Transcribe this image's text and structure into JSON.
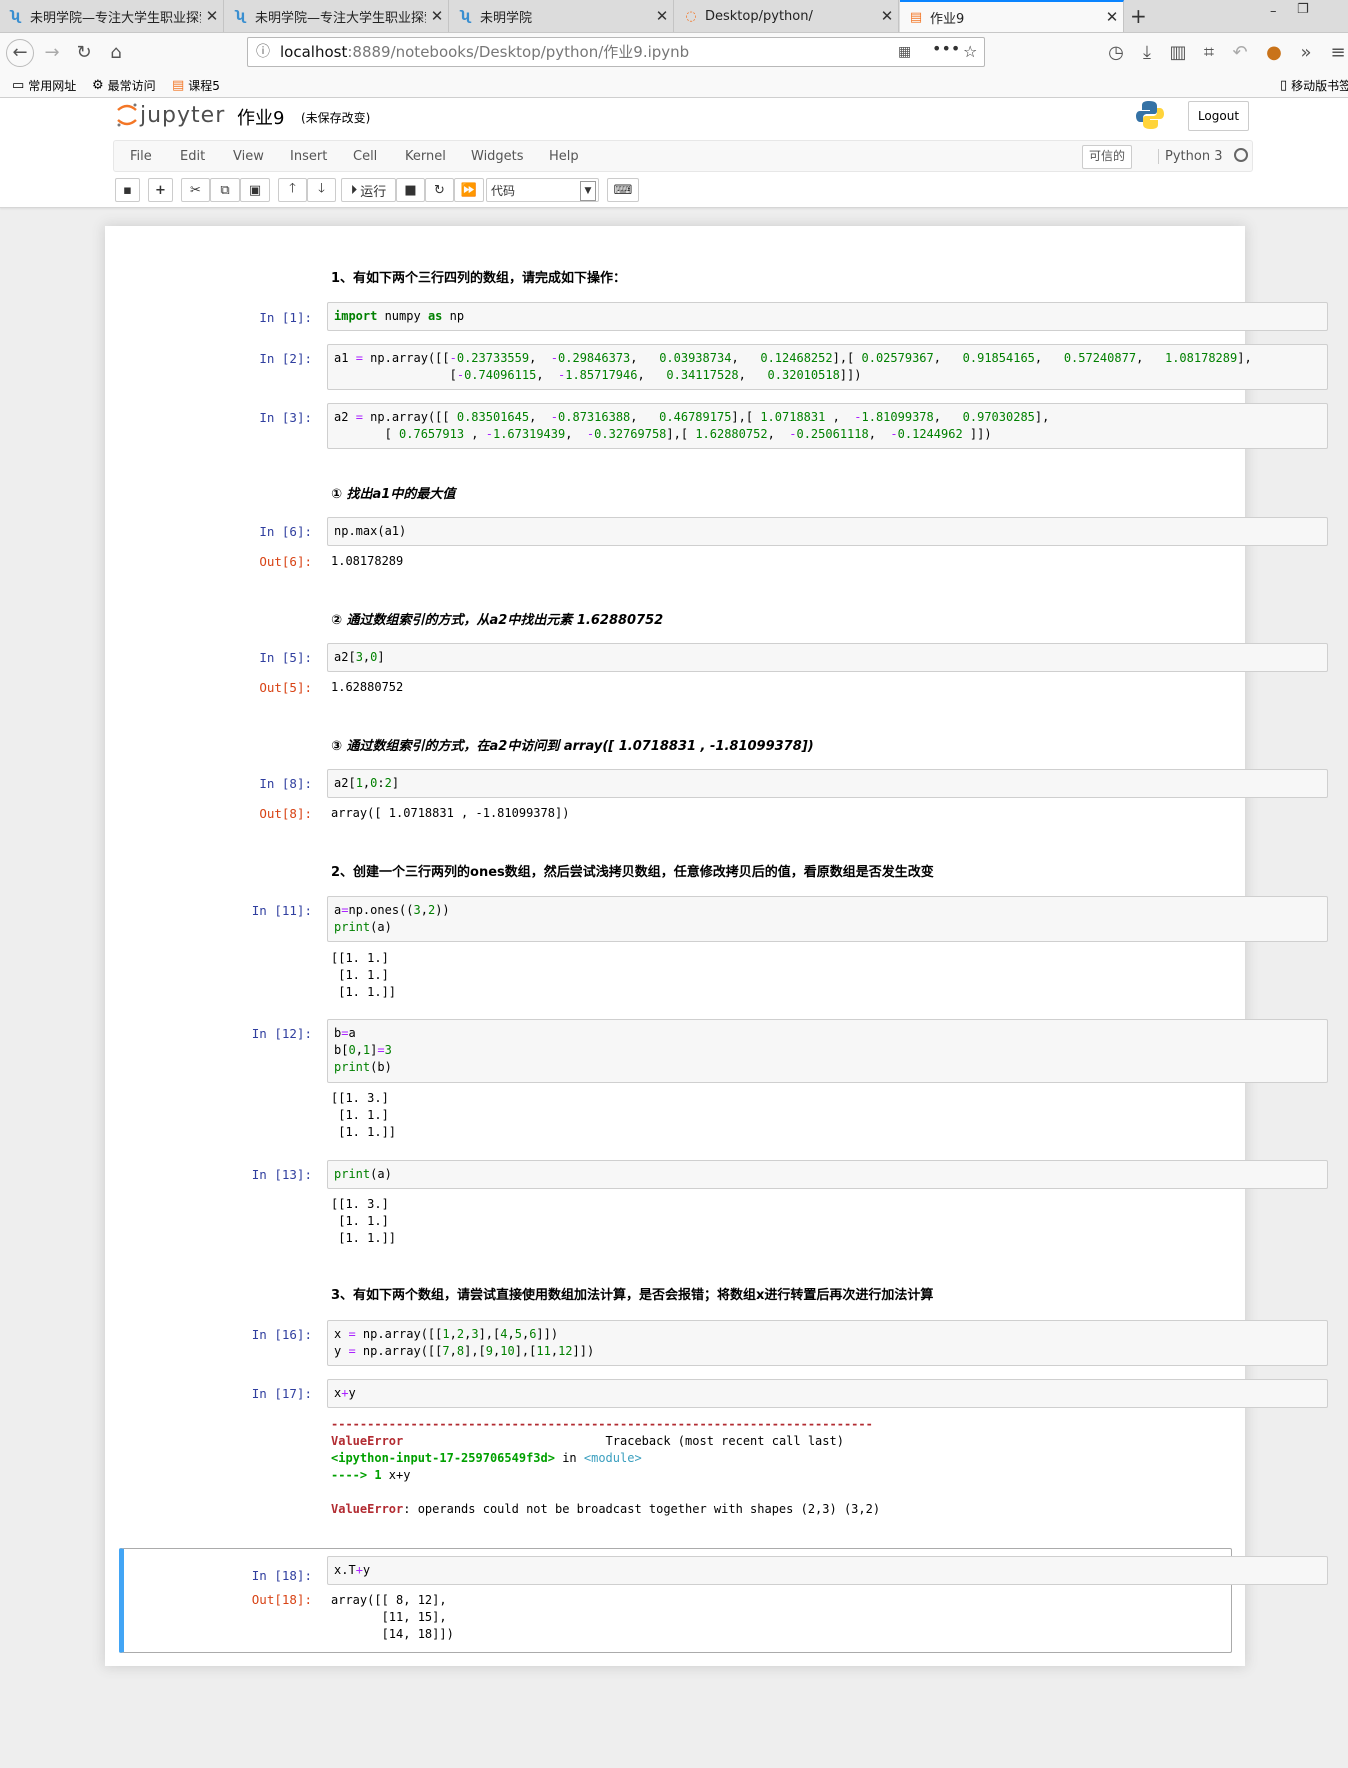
{
  "browser": {
    "tabs": [
      {
        "label": "未明学院—专注大学生职业探索",
        "icon": "weiming-logo-icon"
      },
      {
        "label": "未明学院—专注大学生职业探索",
        "icon": "weiming-logo-icon"
      },
      {
        "label": "未明学院",
        "icon": "weiming-logo-icon"
      },
      {
        "label": "Desktop/python/",
        "icon": "jupyter-logo-icon"
      },
      {
        "label": "作业9",
        "icon": "notebook-icon"
      }
    ],
    "url_host": "localhost",
    "url_rest": ":8889/notebooks/Desktop/python/作业9.ipynb",
    "bookmarks": [
      "常用网址",
      "最常访问",
      "课程5"
    ],
    "mobile_bookmarks": "移动版书签"
  },
  "jupyter": {
    "logo_text": "jupyter",
    "notebook_name": "作业9",
    "save_status": "(未保存改变)",
    "logout": "Logout",
    "menus": [
      "File",
      "Edit",
      "View",
      "Insert",
      "Cell",
      "Kernel",
      "Widgets",
      "Help"
    ],
    "trusted": "可信的",
    "kernel": "Python 3",
    "run_label": "运行",
    "cell_type": "代码"
  },
  "cells": {
    "md1": "1、有如下两个三行四列的数组，请完成如下操作：",
    "p1": "In  [1]:",
    "p2": "In  [2]:",
    "p3": "In  [3]:",
    "md2": "① 找出a1中的最大值",
    "p6": "In  [6]:",
    "o6": "Out[6]:",
    "out6": "1.08178289",
    "md3": "② 通过数组索引的方式，从a2中找出元素 1.62880752",
    "p5": "In  [5]:",
    "o5": "Out[5]:",
    "out5": "1.62880752",
    "md4": "③ 通过数组索引的方式，在a2中访问到 array([ 1.0718831 , -1.81099378])",
    "p8": "In  [8]:",
    "o8": "Out[8]:",
    "out8": "array([ 1.0718831 , -1.81099378])",
    "md5": "2、创建一个三行两列的ones数组，然后尝试浅拷贝数组，任意修改拷贝后的值，看原数组是否发生改变",
    "p11": "In  [11]:",
    "out11": "[[1. 1.]\n [1. 1.]\n [1. 1.]]",
    "p12": "In  [12]:",
    "out12": "[[1. 3.]\n [1. 1.]\n [1. 1.]]",
    "p13": "In  [13]:",
    "out13": "[[1. 3.]\n [1. 1.]\n [1. 1.]]",
    "md6": "3、有如下两个数组，请尝试直接使用数组加法计算，是否会报错；将数组x进行转置后再次进行加法计算",
    "p16": "In  [16]:",
    "p17": "In  [17]:",
    "tb_line": "---------------------------------------------------------------------------",
    "tb_err": "ValueError",
    "tb_head": "Traceback (most recent call last)",
    "tb_input": "<ipython-input-17-259706549f3d>",
    "tb_in": " in ",
    "tb_module": "<module>",
    "tb_arrow": "----> 1",
    "tb_code": " x+y",
    "tb_msg": ": operands could not be broadcast together with shapes (2,3) (3,2) ",
    "p18": "In  [18]:",
    "o18": "Out[18]:",
    "out18": "array([[ 8, 12],\n       [11, 15],\n       [14, 18]])"
  }
}
